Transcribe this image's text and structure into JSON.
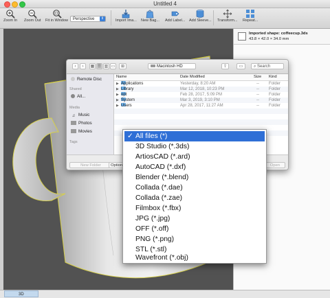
{
  "window": {
    "title": "Untitled 4"
  },
  "toolbar": {
    "zoom_in": "Zoom In",
    "zoom_out": "Zoom Out",
    "fit_in_window": "Fit in Window",
    "view_mode": "Perspective",
    "import": "Import Ima...",
    "new_bag": "New Bag...",
    "add_label": "Add Label...",
    "add_sleeve": "Add Sleeve...",
    "transform": "Transform...",
    "repeat": "Repeat..."
  },
  "info": {
    "imported_shape": "Imported shape: coffeecup.3ds",
    "dimensions": "43.8 × 42.0 × 34.0 mm"
  },
  "dialog": {
    "location": "Macintosh HD",
    "search_placeholder": "Search",
    "sidebar": {
      "remote_disc": "Remote Disc",
      "shared_header": "Shared",
      "all": "All...",
      "media_header": "Media",
      "music": "Music",
      "photos": "Photos",
      "movies": "Movies",
      "tags_header": "Tags"
    },
    "columns": {
      "name": "Name",
      "date": "Date Modified",
      "size": "Size",
      "kind": "Kind"
    },
    "rows": [
      {
        "name": "Applications",
        "date": "Yesterday, 8:20 AM",
        "size": "--",
        "kind": "Folder"
      },
      {
        "name": "Library",
        "date": "Mar 12, 2018, 10:23 PM",
        "size": "--",
        "kind": "Folder"
      },
      {
        "name": "opt",
        "date": "Feb 28, 2017, 5:09 PM",
        "size": "--",
        "kind": "Folder"
      },
      {
        "name": "System",
        "date": "Mar 3, 2019, 3:10 PM",
        "size": "--",
        "kind": "Folder"
      },
      {
        "name": "Users",
        "date": "Apr 28, 2017, 11:27 AM",
        "size": "--",
        "kind": "Folder"
      }
    ],
    "new_folder": "New Folder",
    "options": "Options",
    "open": "Open"
  },
  "file_types": {
    "selected": "All files (*)",
    "items": [
      "All files (*)",
      "3D Studio (*.3ds)",
      "ArtiosCAD (*.ard)",
      "AutoCAD (*.dxf)",
      "Blender (*.blend)",
      "Collada (*.dae)",
      "Collada (*.zae)",
      "Filmbox (*.fbx)",
      "JPG (*.jpg)",
      "OFF (*.off)",
      "PNG (*.png)",
      "STL (*.stl)",
      "Wavefront (*.obj)"
    ]
  },
  "status": {
    "tab": "3D"
  },
  "colors": {
    "accent": "#2f6fd6",
    "viewport": "#525252",
    "folder": "#6aaee8"
  }
}
